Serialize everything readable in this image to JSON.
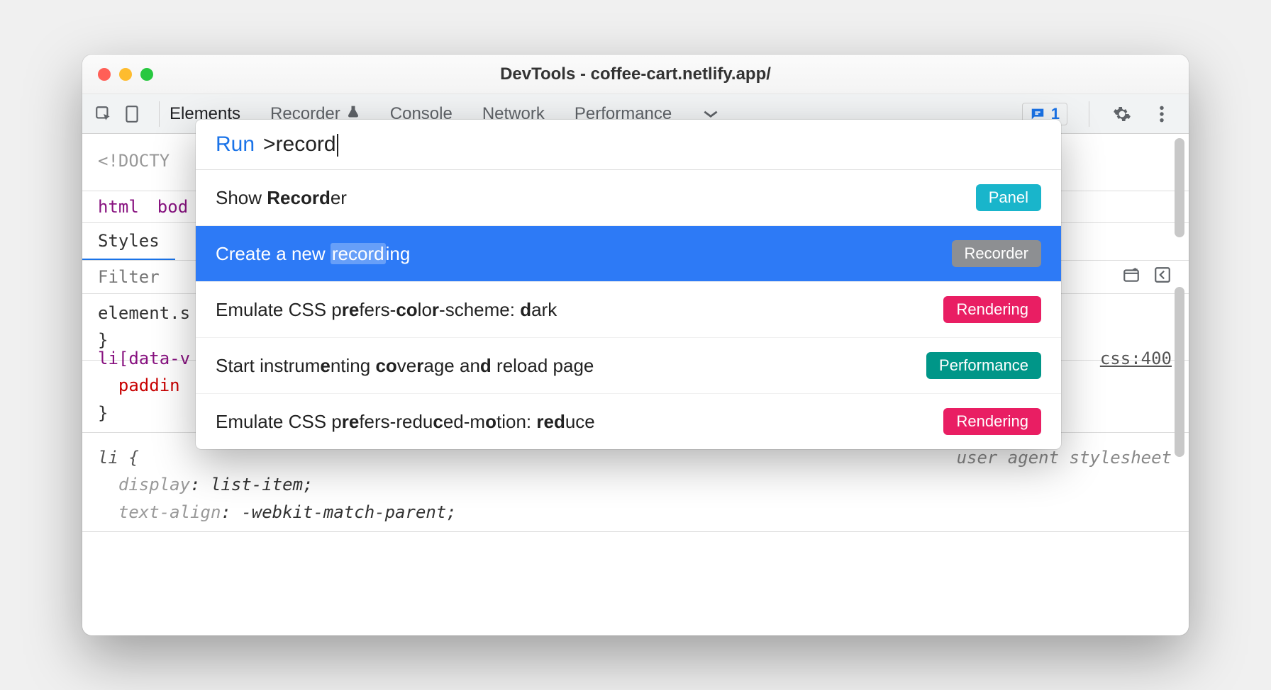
{
  "window": {
    "title": "DevTools - coffee-cart.netlify.app/"
  },
  "tabs": {
    "elements": "Elements",
    "recorder": "Recorder",
    "console": "Console",
    "network": "Network",
    "performance": "Performance"
  },
  "issues": {
    "count": "1"
  },
  "code": {
    "doctype": "<!DOCTY",
    "crumb_html": "html",
    "crumb_body": "bod",
    "styles_tab": "Styles",
    "filter_placeholder": "Filter",
    "block1_sel": "element.s",
    "block1_close": "}",
    "block2_sel": "li[data-v",
    "block2_prop": "paddin",
    "block2_close": "}",
    "block2_src": "css:400",
    "block3_sel": "li {",
    "block3_prop1": "display",
    "block3_val1": "list-item",
    "block3_prop2": "text-align",
    "block3_val2": "-webkit-match-parent",
    "block3_ua": "user agent stylesheet"
  },
  "palette": {
    "prefix": "Run",
    "query": ">record",
    "items": [
      {
        "text_pre": "Show ",
        "text_b": "Record",
        "text_post": "er",
        "badge": "Panel",
        "badge_class": "panel",
        "selected": false
      },
      {
        "text_pre": "Create a new ",
        "text_hl": "record",
        "text_post": "ing",
        "badge": "Recorder",
        "badge_class": "recorder",
        "selected": true
      },
      {
        "label": "Emulate CSS prefers-color-scheme: dark",
        "badge": "Rendering",
        "badge_class": "rendering",
        "selected": false
      },
      {
        "label": "Start instrumenting coverage and reload page",
        "badge": "Performance",
        "badge_class": "perf",
        "selected": false
      },
      {
        "label": "Emulate CSS prefers-reduced-motion: reduce",
        "badge": "Rendering",
        "badge_class": "rendering",
        "selected": false
      }
    ]
  }
}
